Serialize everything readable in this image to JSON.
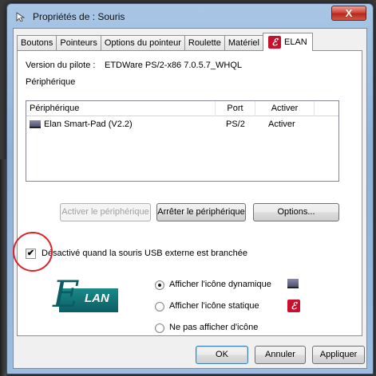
{
  "window": {
    "title": "Propriétés de : Souris",
    "close_label": "X"
  },
  "tabs": [
    {
      "label": "Boutons"
    },
    {
      "label": "Pointeurs"
    },
    {
      "label": "Options du pointeur"
    },
    {
      "label": "Roulette"
    },
    {
      "label": "Matériel"
    },
    {
      "label": "ELAN",
      "icon": "elan-icon",
      "active": true
    }
  ],
  "panel": {
    "driver_label": "Version du pilote :",
    "driver_value": "ETDWare PS/2-x86 7.0.5.7_WHQL",
    "device_section_label": "Périphérique",
    "list": {
      "columns": [
        "Périphérique",
        "Port",
        "Activer"
      ],
      "rows": [
        {
          "device": "Elan Smart-Pad  (V2.2)",
          "port": "PS/2",
          "status": "Activer",
          "icon": "touchpad-icon"
        }
      ]
    },
    "buttons": {
      "activate": "Activer le périphérique",
      "stop": "Arrêter le périphérique",
      "options": "Options..."
    },
    "checkbox": {
      "label": "Désactivé quand la souris USB externe est branchée",
      "checked": true,
      "mark": "✔"
    },
    "logo_text": "LAN",
    "logo_script": "E",
    "radios": [
      {
        "label": "Afficher l'icône dynamique",
        "checked": true,
        "icon": "touchpad-icon"
      },
      {
        "label": "Afficher l'icône statique",
        "checked": false,
        "icon": "elan-icon"
      },
      {
        "label": "Ne pas afficher d'icône",
        "checked": false
      }
    ]
  },
  "footer": {
    "ok": "OK",
    "cancel": "Annuler",
    "apply": "Appliquer"
  },
  "colors": {
    "highlight_circle": "#e0202a",
    "elan_red": "#c8102e",
    "elan_teal": "#0b5d63"
  }
}
